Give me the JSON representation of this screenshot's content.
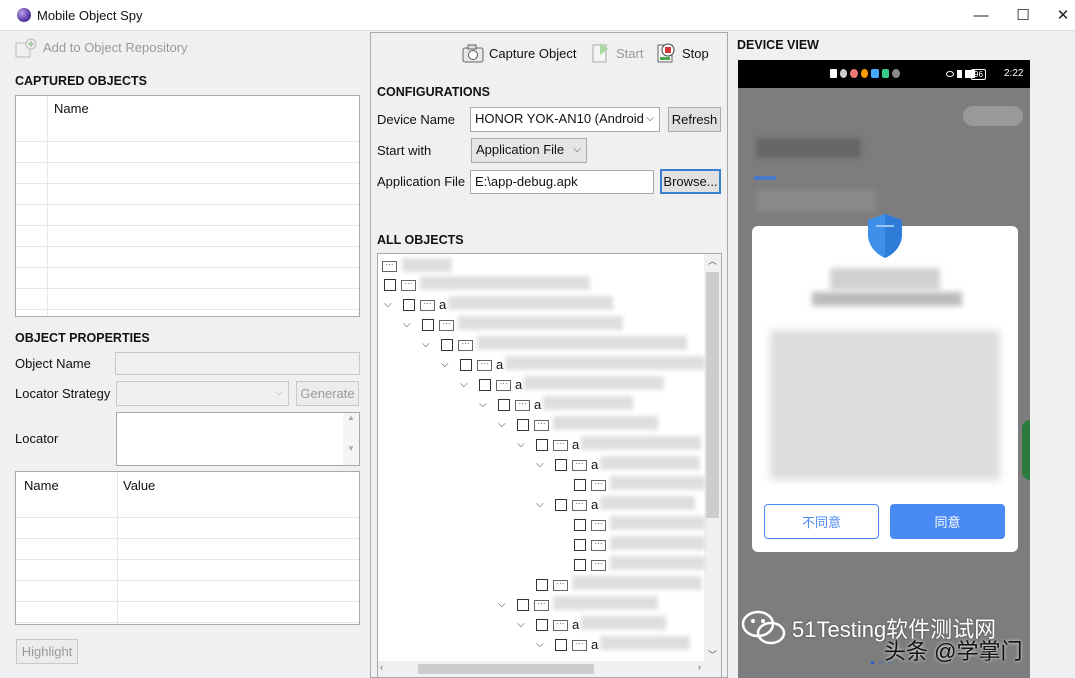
{
  "window": {
    "title": "Mobile Object Spy",
    "minimize": "—",
    "maximize": "☐",
    "close": "✕"
  },
  "left": {
    "add_repo": "Add to Object Repository",
    "captured_title": "CAPTURED OBJECTS",
    "captured_col": "Name",
    "props_title": "OBJECT PROPERTIES",
    "object_name_label": "Object Name",
    "locator_strategy_label": "Locator Strategy",
    "generate": "Generate",
    "locator_label": "Locator",
    "table_cols": [
      "Name",
      "Value"
    ],
    "highlight": "Highlight"
  },
  "middle": {
    "capture": "Capture Object",
    "start": "Start",
    "stop": "Stop",
    "config_title": "CONFIGURATIONS",
    "device_name_label": "Device Name",
    "device_name_value": "HONOR YOK-AN10 (Android",
    "refresh": "Refresh",
    "start_with_label": "Start with",
    "start_with_value": "Application File",
    "app_file_label": "Application File",
    "app_file_value": "E:\\app-debug.apk",
    "browse": "Browse...",
    "all_objects_title": "ALL OBJECTS",
    "tree_letters": [
      "a",
      "a",
      "a",
      "a",
      "a",
      "a",
      "a",
      "a",
      "a"
    ]
  },
  "device": {
    "title": "DEVICE VIEW",
    "clock": "2:22",
    "battery": "96",
    "disagree": "不同意",
    "agree": "同意"
  },
  "watermark": {
    "line1": "51Testing软件测试网",
    "line2": "头条 @学掌门"
  },
  "colors": {
    "accent": "#4a8af4",
    "shield": "#3d8fea"
  }
}
